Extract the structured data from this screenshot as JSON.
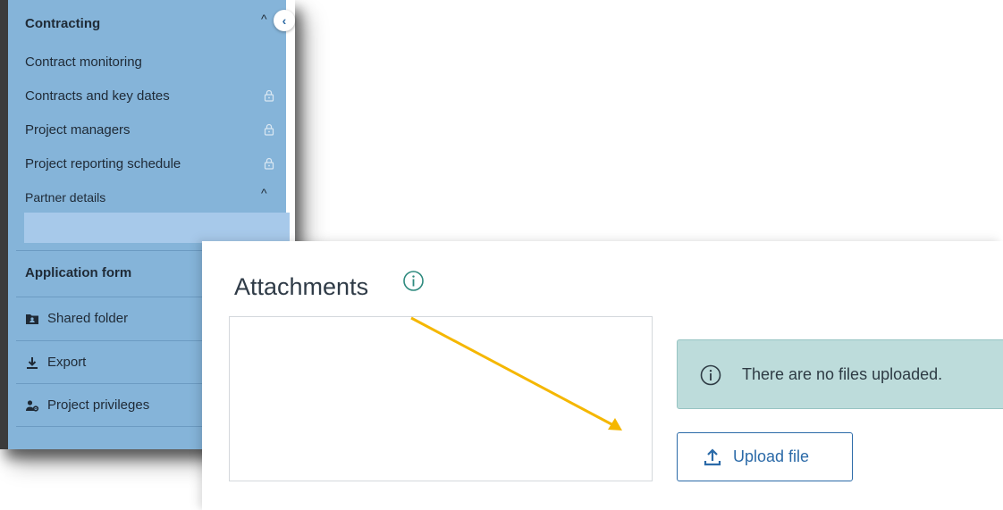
{
  "sidebar": {
    "section_title": "Contracting",
    "collapse_label": "‹",
    "contracting_caret": "^",
    "items": [
      {
        "label": "Contract monitoring",
        "locked": false
      },
      {
        "label": "Contracts and key dates",
        "locked": true
      },
      {
        "label": "Project managers",
        "locked": true
      },
      {
        "label": "Project reporting schedule",
        "locked": true
      },
      {
        "label": "Partner details",
        "locked": false
      }
    ],
    "partner_caret": "^",
    "application_form": "Application form",
    "menu": [
      {
        "label": "Shared folder",
        "icon": "folder-account-icon"
      },
      {
        "label": "Export",
        "icon": "download-icon"
      },
      {
        "label": "Project privileges",
        "icon": "user-cog-icon"
      }
    ]
  },
  "attachments": {
    "title": "Attachments",
    "notice": "There are no files uploaded.",
    "upload_label": "Upload file"
  },
  "colors": {
    "sidebar_bg": "#85b4d9",
    "accent": "#2b6aa8",
    "notice_bg": "#bddcdb",
    "arrow": "#f5b700"
  }
}
